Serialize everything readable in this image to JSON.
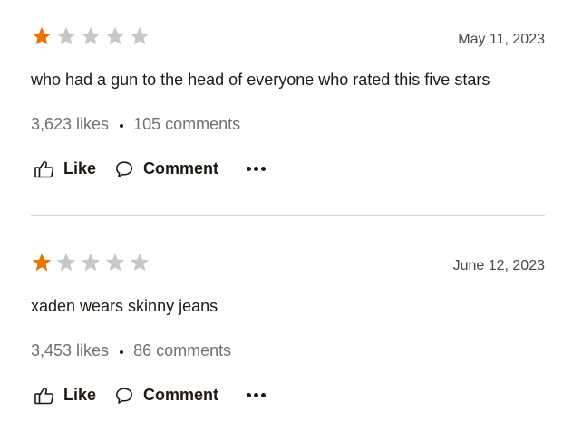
{
  "colors": {
    "star_filled": "#e87400",
    "star_empty": "#c7c7c7",
    "text": "#1e1915",
    "muted": "#707070",
    "divider": "#d8d8d8"
  },
  "reviews": [
    {
      "rating": 1,
      "max_rating": 5,
      "date": "May 11, 2023",
      "text": "who had a gun to the head of everyone who rated this five stars",
      "likes": "3,623 likes",
      "comments": "105 comments",
      "like_label": "Like",
      "comment_label": "Comment",
      "more_icon": "more-horizontal-icon"
    },
    {
      "rating": 1,
      "max_rating": 5,
      "date": "June 12, 2023",
      "text": "xaden wears skinny jeans",
      "likes": "3,453 likes",
      "comments": "86 comments",
      "like_label": "Like",
      "comment_label": "Comment",
      "more_icon": "more-horizontal-icon"
    }
  ]
}
